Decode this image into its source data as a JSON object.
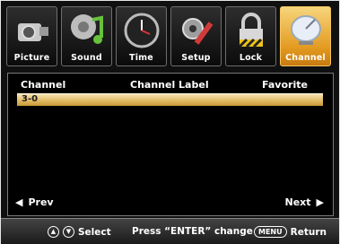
{
  "tabs": [
    {
      "label": "Picture",
      "icon": "camera-icon"
    },
    {
      "label": "Sound",
      "icon": "music-note-icon"
    },
    {
      "label": "Time",
      "icon": "clock-icon"
    },
    {
      "label": "Setup",
      "icon": "tools-icon"
    },
    {
      "label": "Lock",
      "icon": "padlock-icon"
    },
    {
      "label": "Channel",
      "icon": "satellite-dish-icon",
      "active": true
    }
  ],
  "list": {
    "headers": {
      "channel": "Channel",
      "channel_label": "Channel Label",
      "favorite": "Favorite"
    },
    "rows": [
      {
        "channel": "3-0",
        "label": "",
        "favorite": ""
      }
    ]
  },
  "nav": {
    "prev": "Prev",
    "next": "Next"
  },
  "footer": {
    "select": "Select",
    "enter_hint": "Press “ENTER” change",
    "menu_key": "MENU",
    "return": "Return"
  },
  "colors": {
    "accent": "#e39a20",
    "selection": "#e0b75e"
  }
}
